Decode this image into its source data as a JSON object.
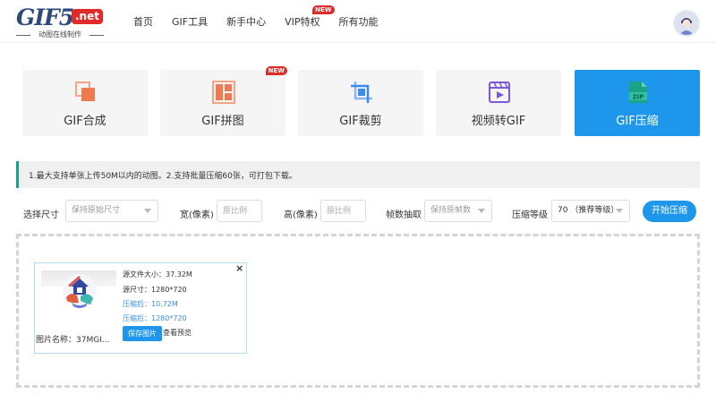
{
  "header": {
    "logo": {
      "main": "GIF5",
      "net": ".net",
      "subtitle": "动图在线制作"
    },
    "nav": [
      {
        "label": "首页"
      },
      {
        "label": "GIF工具"
      },
      {
        "label": "新手中心"
      },
      {
        "label": "VIP特权",
        "badge": "NEW"
      },
      {
        "label": "所有功能"
      }
    ],
    "avatar_icon": "user-avatar-icon"
  },
  "tools": [
    {
      "label": "GIF合成",
      "icon": "merge-squares-icon",
      "color": "#f07a4f"
    },
    {
      "label": "GIF拼图",
      "icon": "grid-collage-icon",
      "color": "#f07a4f",
      "badge": "NEW"
    },
    {
      "label": "GIF裁剪",
      "icon": "crop-icon",
      "color": "#3d8be8"
    },
    {
      "label": "视频转GIF",
      "icon": "video-file-icon",
      "color": "#7a5ad8"
    },
    {
      "label": "GIF压缩",
      "icon": "zip-file-icon",
      "color": "#1aa385",
      "active": true
    }
  ],
  "tip": "1.最大支持单张上传50M以内的动图。2.支持批量压缩60张，可打包下载。",
  "options": {
    "size_label": "选择尺寸",
    "size_value": "保持原始尺寸",
    "width_label": "宽(像素)",
    "width_placeholder": "原比例",
    "height_label": "高(像素)",
    "height_placeholder": "原比例",
    "frames_label": "帧数抽取",
    "frames_value": "保持原帧数",
    "level_label": "压缩等级",
    "level_value": "70 （推荐等级）",
    "start_button": "开始压缩"
  },
  "file": {
    "source_size": "源文件大小：37.32M",
    "source_dims": "源尺寸：1280*720",
    "compressed_size": "压缩后：10.72M",
    "compressed_dims": "压缩后：1280*720",
    "name": "图片名称：37MGI...",
    "save_button": "保存图片",
    "preview_link": "查看预览",
    "close": "×"
  },
  "colors": {
    "accent": "#1e96ec",
    "tip_border": "#14a38f",
    "badge": "#e02b2b",
    "compressed_text": "#3a8ee6"
  }
}
